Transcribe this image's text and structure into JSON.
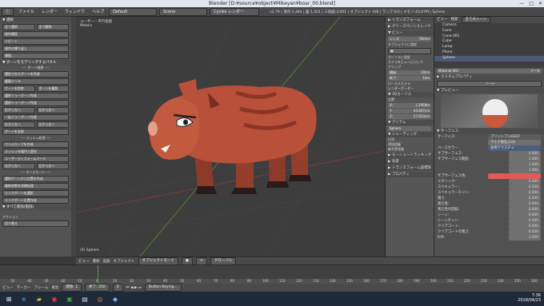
{
  "window": {
    "title": "Blender [D:¥source¥object¥Mikeyan¥boar_00.blend]",
    "min": "—",
    "max": "□",
    "close": "✕"
  },
  "menu": {
    "file": "ファイル",
    "render": "レンダー",
    "window": "ウィンドウ",
    "help": "ヘルプ",
    "layout": "Default",
    "scene": "Scene",
    "engine": "Cycles レンダー",
    "stats": "v2.79 | 頂点:1,484 | 面:1,501 | 三角面:3,001 | オブジェクト:0/8 | ランプ:0/3 | メモリ:43.07M | Sphere"
  },
  "toolshelf": {
    "panel1": "▼ 選択",
    "row1": [
      "全て選択",
      "全て解除"
    ],
    "b1": "操作履歴",
    "b2": "リピート",
    "b3": "操作の繰り返し",
    "b4": "履歴...",
    "panel2": "▼ ボーンをモデリングするパネル",
    "sep1": "---- ボーン階層 ----",
    "b5": "選択されたボーンを作成",
    "b6": "複製ツール",
    "row2": [
      "ボーンを削除",
      "ボーンを複製"
    ],
    "b7": "選択ミラーボーン作成",
    "b8": "選択ミラーボーン作成",
    "row3": [
      "右から左へ",
      "左から右へ"
    ],
    "b9": "一括ミラーボーン作成",
    "row4": [
      "右から左へ",
      "左から右へ"
    ],
    "b10": "ボーンを名前",
    "sep2": "---- メッシュ処理 ----",
    "b11": "ベベルカーブを作成",
    "b12": "メッシュを楕円で変形",
    "b13": "ユーザーディフォームツール",
    "row5": [
      "右から左へ",
      "左から右へ"
    ],
    "sep3": "---- ポーズモード ----",
    "b14": "選択ボーンから位置を作成",
    "b15": "最新状態を同期処理",
    "b16": "リンクボーンを選択",
    "b17": "リンクボーン位置作成",
    "panel3": "▼ すべて削除(削除)",
    "action_label": "アクション",
    "action_value": "切り替え"
  },
  "viewport": {
    "view_label": "ユーザー・平行投影",
    "units": "Meters",
    "object_label": "(0) Sphere"
  },
  "rightcol": {
    "h1": "▶ トランスフォーム",
    "h2": "▶ グリースペンシルレイヤー",
    "h3": "▼ ビュー",
    "lens_label": "レンズ",
    "lens_value": "50mm",
    "lockobj": "オブジェクトに固定",
    "lockcursor": "カーソルに固定",
    "lockcam": "カメラをビューにロック",
    "clip": "クリップ",
    "clip_start": "10cm",
    "clip_end": "1km",
    "localcam": "ローカルカメラ",
    "render_border": "レンダーボーダー",
    "h4": "▼ 3Dカーソル",
    "loc": "位置",
    "x": "1.2958m",
    "y": "43.847cm",
    "z": "27.633cm",
    "h5": "▼ アイテム",
    "item_name": "Sphere",
    "h6": "▼ シェーディング",
    "sh1": "行列",
    "sh2": "環境遮蔽",
    "sh3": "被写界深度",
    "h7": "▶ モーショントラッキング",
    "h8": "▶ 背景",
    "h9": "▶ トランスフォーム座標系",
    "h10": "▶ プロパティ"
  },
  "outliner": {
    "view": "ビュー",
    "search": "検索",
    "scenes": "全てのシーン",
    "items": [
      "Camera",
      "Cone",
      "Cone.001",
      "Cube",
      "Lamp",
      "Plane",
      "Sphere"
    ]
  },
  "props": {
    "material": "Material.001",
    "data": "データ",
    "customprops": "▶ カスタムプロパティ",
    "mode": "ノード",
    "preview": "▼ プレビュー",
    "surface": "▼ サーフェス",
    "surface_label": "サーフェス:",
    "surface_value": "プリンシプルBSDF",
    "dist": "マルチ散乱GGX",
    "base": "ベースカラー",
    "base_value": "画像テクスチャ",
    "rows": [
      [
        "サブサーフェス:",
        "0.000"
      ],
      [
        "サブサーフェス範囲:",
        "1.000"
      ],
      [
        "",
        "1.000"
      ],
      [
        "",
        "1.000"
      ],
      [
        "サブサーフェス色:",
        ""
      ],
      [
        "メタリック:",
        "0.000"
      ],
      [
        "スペキュラー:",
        "0.500"
      ],
      [
        "スペキュラーチント:",
        "0.000"
      ],
      [
        "粗さ:",
        "0.500"
      ],
      [
        "異方性:",
        "0.000"
      ],
      [
        "異方性の回転:",
        "0.000"
      ],
      [
        "シーン:",
        "0.000"
      ],
      [
        "シーンチント:",
        "0.500"
      ],
      [
        "クリアコート:",
        "0.000"
      ],
      [
        "クリアコートの粗さ:",
        "0.030"
      ],
      [
        "IOR:",
        "1.450"
      ]
    ]
  },
  "bottombar": {
    "view": "ビュー",
    "select": "選択",
    "add": "追加",
    "object": "オブジェクト",
    "mode": "オブジェクトモード",
    "pivot": "グローバル"
  },
  "timeline": {
    "ticks": [
      "-50",
      "-40",
      "-30",
      "-20",
      "-10",
      "0",
      "10",
      "20",
      "30",
      "40",
      "50",
      "60",
      "70",
      "80",
      "90",
      "100",
      "110",
      "120",
      "130",
      "140",
      "150",
      "160",
      "170",
      "180",
      "190",
      "200",
      "210",
      "220",
      "230",
      "240",
      "250",
      "260"
    ],
    "view": "ビュー",
    "marker": "マーカー",
    "frame": "フレーム",
    "playback": "再生",
    "start": "開始: 1",
    "end": "終了: 250",
    "current": "0",
    "keying": "Button Keying..."
  },
  "taskbar": {
    "time": "7:36",
    "date": "2018/04/23"
  },
  "colors": {
    "accent": "#e05a5a",
    "boar_body": "#b8503a",
    "subsurface_color": "#e05a5a"
  }
}
